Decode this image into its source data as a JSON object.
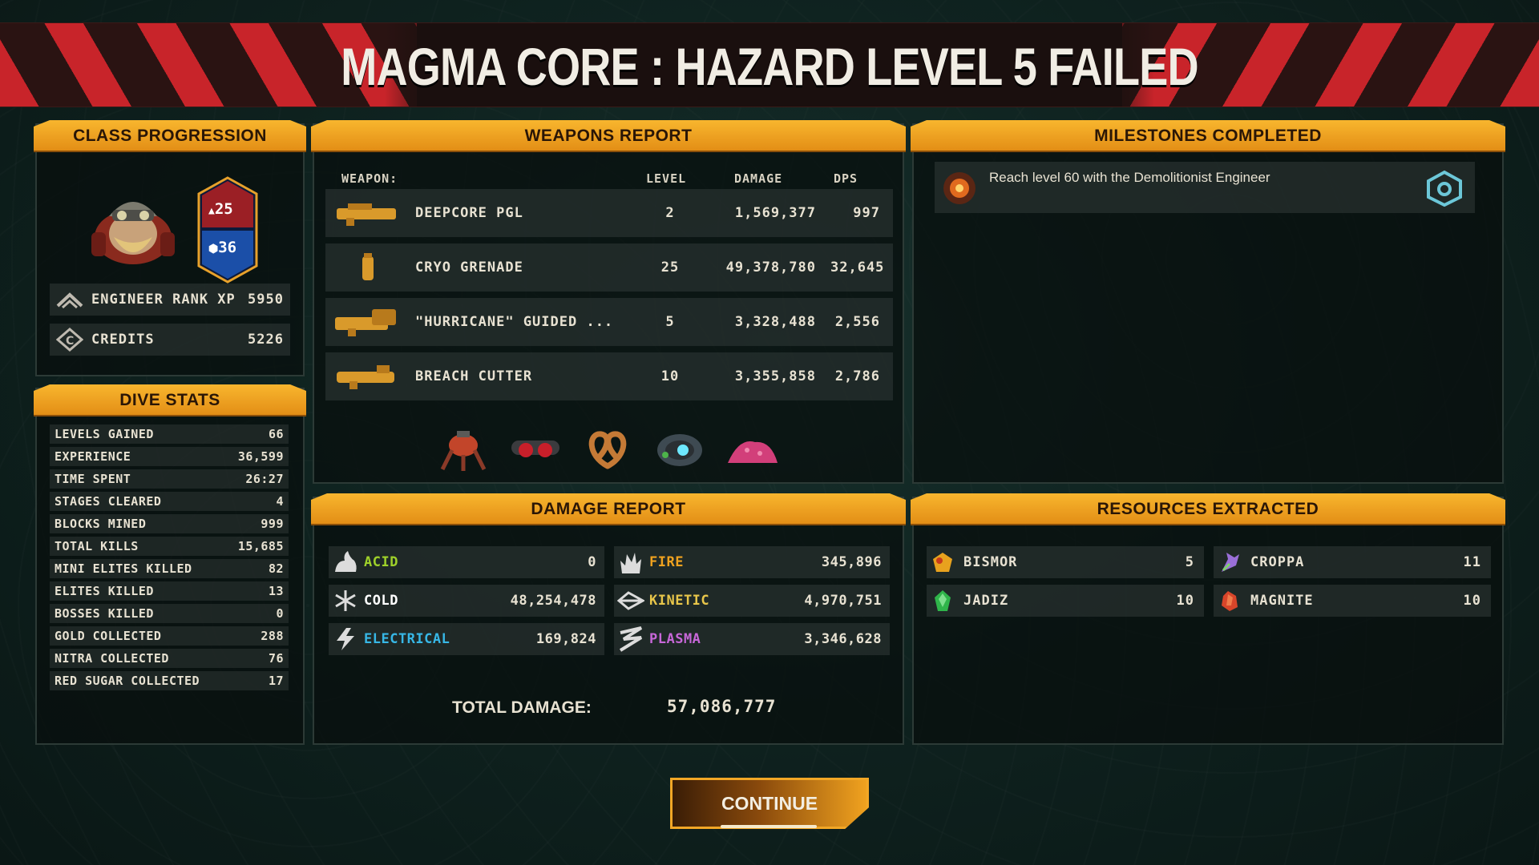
{
  "title": "MAGMA CORE : HAZARD LEVEL 5 FAILED",
  "class_progression": {
    "header": "CLASS PROGRESSION",
    "rank_top": "25",
    "rank_bottom": "36",
    "rank_xp_label": "ENGINEER RANK XP",
    "rank_xp_value": "5950",
    "credits_label": "CREDITS",
    "credits_value": "5226"
  },
  "dive_stats": {
    "header": "DIVE STATS",
    "rows": [
      {
        "label": "LEVELS GAINED",
        "value": "66"
      },
      {
        "label": "EXPERIENCE",
        "value": "36,599"
      },
      {
        "label": "TIME SPENT",
        "value": "26:27"
      },
      {
        "label": "STAGES CLEARED",
        "value": "4"
      },
      {
        "label": "BLOCKS MINED",
        "value": "999"
      },
      {
        "label": "TOTAL KILLS",
        "value": "15,685"
      },
      {
        "label": "MINI ELITES KILLED",
        "value": "82"
      },
      {
        "label": "ELITES KILLED",
        "value": "13"
      },
      {
        "label": "BOSSES KILLED",
        "value": "0"
      },
      {
        "label": "GOLD COLLECTED",
        "value": "288"
      },
      {
        "label": "NITRA COLLECTED",
        "value": "76"
      },
      {
        "label": "RED SUGAR COLLECTED",
        "value": "17"
      }
    ]
  },
  "weapons_report": {
    "header": "WEAPONS REPORT",
    "columns": {
      "weapon": "WEAPON:",
      "level": "LEVEL",
      "damage": "DAMAGE",
      "dps": "DPS"
    },
    "rows": [
      {
        "name": "DEEPCORE PGL",
        "level": "2",
        "damage": "1,569,377",
        "dps": "997",
        "icon": "grenade-launcher-icon"
      },
      {
        "name": "CRYO GRENADE",
        "level": "25",
        "damage": "49,378,780",
        "dps": "32,645",
        "icon": "cryo-grenade-icon"
      },
      {
        "name": "\"HURRICANE\" GUIDED ...",
        "level": "5",
        "damage": "3,328,488",
        "dps": "2,556",
        "icon": "hurricane-launcher-icon"
      },
      {
        "name": "BREACH CUTTER",
        "level": "10",
        "damage": "3,355,858",
        "dps": "2,786",
        "icon": "breach-cutter-icon"
      }
    ],
    "pickups": [
      "turret-drone-icon",
      "goggles-icon",
      "pretzel-icon",
      "crystal-belt-icon",
      "pink-mound-icon"
    ]
  },
  "milestones": {
    "header": "MILESTONES COMPLETED",
    "items": [
      {
        "text": "Reach level 60 with the Demolitionist Engineer"
      }
    ]
  },
  "damage_report": {
    "header": "DAMAGE REPORT",
    "cells": [
      {
        "name": "ACID",
        "value": "0",
        "color": "#9fd12a"
      },
      {
        "name": "FIRE",
        "value": "345,896",
        "color": "#f0a21f"
      },
      {
        "name": "COLD",
        "value": "48,254,478",
        "color": "#ffffff"
      },
      {
        "name": "KINETIC",
        "value": "4,970,751",
        "color": "#e8c64a"
      },
      {
        "name": "ELECTRICAL",
        "value": "169,824",
        "color": "#37b7e6"
      },
      {
        "name": "PLASMA",
        "value": "3,346,628",
        "color": "#c767d8"
      }
    ],
    "total_label": "TOTAL DAMAGE:",
    "total_value": "57,086,777"
  },
  "resources": {
    "header": "RESOURCES EXTRACTED",
    "cells": [
      {
        "name": "BISMOR",
        "value": "5"
      },
      {
        "name": "CROPPA",
        "value": "11"
      },
      {
        "name": "JADIZ",
        "value": "10"
      },
      {
        "name": "MAGNITE",
        "value": "10"
      }
    ]
  },
  "continue_label": "CONTINUE",
  "colors": {
    "accent": "#f0a21f",
    "stripe_red": "#c8242a"
  }
}
